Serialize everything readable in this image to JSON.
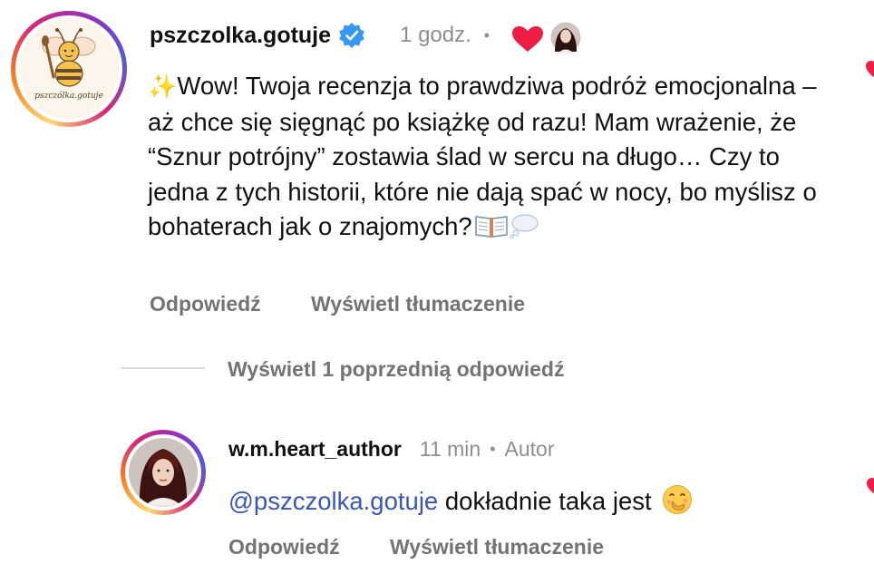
{
  "comment": {
    "username": "pszczolka.gotuje",
    "time": "1 godz.",
    "separator": "•",
    "avatar_caption": "pszczólka.gotuje",
    "text": "Wow! Twoja recenzja to prawdziwa podróż emocjonalna – aż chce się sięgnąć po książkę od razu! Mam wrażenie, że “Sznur potrójny” zostawia ślad w sercu na długo… Czy to jedna z tych historii, które nie dają spać w nocy, bo myślisz o bohaterach jak o znajomych?",
    "reply_label": "Odpowiedź",
    "translate_label": "Wyświetl tłumaczenie"
  },
  "view_previous": "Wyświetl 1 poprzednią odpowiedź",
  "reply": {
    "username": "w.m.heart_author",
    "time": "11 min",
    "separator": "•",
    "badge": "Autor",
    "mention": "@pszczolka.gotuje",
    "text": " dokładnie taka jest",
    "reply_label": "Odpowiedź",
    "translate_label": "Wyświetl tłumaczenie"
  },
  "icons": {
    "verified": "verified-badge-icon",
    "liked_by_author": "heart-icon",
    "sparkles": "sparkles-icon",
    "book": "open-book-icon",
    "thought": "thought-balloon-icon",
    "emoji": "face-with-hand-over-mouth-icon"
  },
  "colors": {
    "heart": "#ed1d45",
    "verified": "#3897f0",
    "mention": "#3a57b6",
    "secondary_text": "#8e8e8e"
  }
}
